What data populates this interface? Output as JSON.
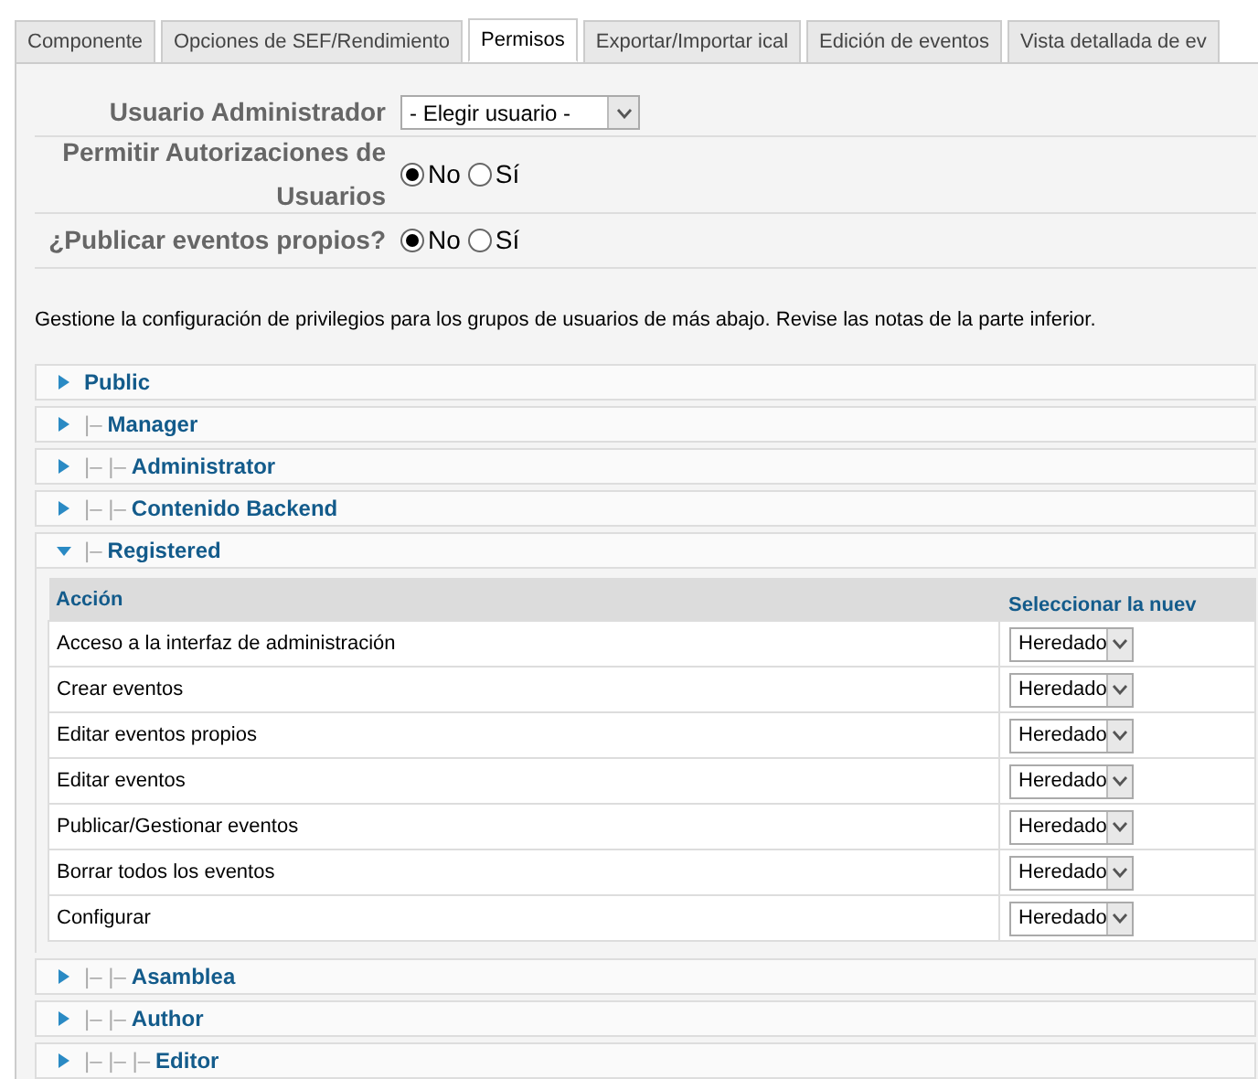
{
  "tabs": [
    {
      "label": "Componente",
      "selected": false
    },
    {
      "label": "Opciones de SEF/Rendimiento",
      "selected": false
    },
    {
      "label": "Permisos",
      "selected": true
    },
    {
      "label": "Exportar/Importar ical",
      "selected": false
    },
    {
      "label": "Edición de eventos",
      "selected": false
    },
    {
      "label": "Vista detallada de ev",
      "selected": false
    }
  ],
  "settings": [
    {
      "kind": "select",
      "label": "Usuario Administrador",
      "value": "- Elegir usuario -"
    },
    {
      "kind": "radio",
      "label": "Permitir Autorizaciones de Usuarios",
      "options": [
        {
          "label": "No",
          "selected": true
        },
        {
          "label": "Sí",
          "selected": false
        }
      ]
    },
    {
      "kind": "radio",
      "label": "¿Publicar eventos propios?",
      "options": [
        {
          "label": "No",
          "selected": true
        },
        {
          "label": "Sí",
          "selected": false
        }
      ]
    }
  ],
  "description": "Gestione la configuración de privilegios para los grupos de usuarios de más abajo. Revise las notas de la parte inferior.",
  "groups": [
    {
      "name": "Public",
      "expanded": false
    },
    {
      "prefix": "|–",
      "name": "Manager",
      "expanded": false
    },
    {
      "prefix": "|– |–",
      "name": "Administrator",
      "expanded": false
    },
    {
      "prefix": "|– |–",
      "name": "Contenido Backend",
      "expanded": false
    },
    {
      "prefix": "|–",
      "name": "Registered",
      "expanded": true,
      "table": {
        "columns": [
          "Acción",
          "Seleccionar la nuev"
        ],
        "rows": [
          {
            "action": "Acceso a la interfaz de administración",
            "setting": "Heredado"
          },
          {
            "action": "Crear eventos",
            "setting": "Heredado"
          },
          {
            "action": "Editar eventos propios",
            "setting": "Heredado"
          },
          {
            "action": "Editar eventos",
            "setting": "Heredado"
          },
          {
            "action": "Publicar/Gestionar eventos",
            "setting": "Heredado"
          },
          {
            "action": "Borrar todos los eventos",
            "setting": "Heredado"
          },
          {
            "action": "Configurar",
            "setting": "Heredado"
          }
        ]
      }
    },
    {
      "prefix": "|– |–",
      "name": "Asamblea",
      "expanded": false
    },
    {
      "prefix": "|– |–",
      "name": "Author",
      "expanded": false
    },
    {
      "prefix": "|– |– |–",
      "name": "Editor",
      "expanded": false
    }
  ]
}
